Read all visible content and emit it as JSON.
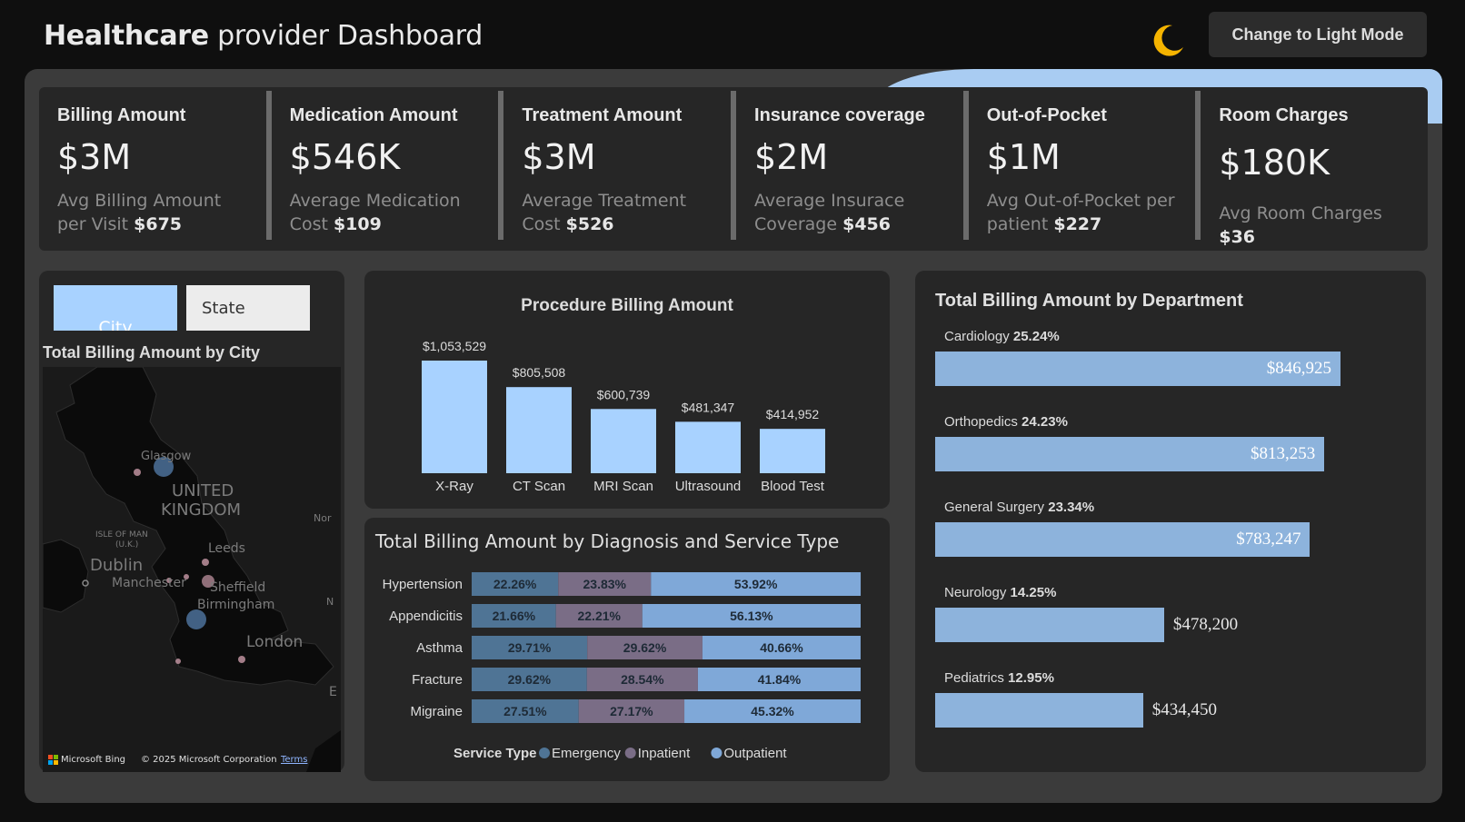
{
  "header": {
    "title_bold": "Healthcare",
    "title_rest": " provider Dashboard",
    "mode_button": "Change to Light Mode"
  },
  "kpis": [
    {
      "label": "Billing Amount",
      "value": "$3M",
      "sub": "Avg Billing Amount per Visit ",
      "sub_value": "$675"
    },
    {
      "label": "Medication Amount",
      "value": "$546K",
      "sub": "Average Medication Cost ",
      "sub_value": "$109"
    },
    {
      "label": "Treatment Amount",
      "value": "$3M",
      "sub": "Average Treatment Cost ",
      "sub_value": "$526"
    },
    {
      "label": "Insurance coverage",
      "value": "$2M",
      "sub": "Average Insurace Coverage ",
      "sub_value": "$456"
    },
    {
      "label": "Out-of-Pocket",
      "value": "$1M",
      "sub": "Avg Out-of-Pocket per patient ",
      "sub_value": "$227"
    },
    {
      "label": "Room Charges",
      "value": "$180K",
      "sub": "Avg Room Charges ",
      "sub_value": "$36"
    }
  ],
  "map": {
    "city_button": "City",
    "state_button": "State",
    "title": "Total Billing Amount by City",
    "labels": {
      "glasgow": "Glasgow",
      "uk_line1": "UNITED",
      "uk_line2": "KINGDOM",
      "isle_line1": "ISLE OF MAN",
      "isle_line2": "(U.K.)",
      "dublin": "Dublin",
      "leeds": "Leeds",
      "manchester": "Manchester",
      "sheffield": "Sheffield",
      "birmingham": "Birmingham",
      "london": "London",
      "nor": "Nor",
      "n": "N",
      "e": "E"
    },
    "bing": "Microsoft Bing",
    "copyright": "© 2025 Microsoft Corporation",
    "terms": "Terms"
  },
  "chart_data": [
    {
      "type": "bar",
      "title": "Procedure Billing Amount",
      "categories": [
        "X-Ray",
        "CT Scan",
        "MRI Scan",
        "Ultrasound",
        "Blood Test"
      ],
      "values": [
        1053529,
        805508,
        600739,
        481347,
        414952
      ],
      "value_labels": [
        "$1,053,529",
        "$805,508",
        "$600,739",
        "$481,347",
        "$414,952"
      ],
      "color": "#a8d2ff"
    },
    {
      "type": "bar",
      "orientation": "horizontal-stacked-100",
      "title": "Total Billing Amount by Diagnosis and Service Type",
      "categories": [
        "Hypertension",
        "Appendicitis",
        "Asthma",
        "Fracture",
        "Migraine"
      ],
      "legend_title": "Service Type",
      "series": [
        {
          "name": "Emergency",
          "color": "#4f7495",
          "values": [
            22.26,
            21.66,
            29.71,
            29.62,
            27.51
          ]
        },
        {
          "name": "Inpatient",
          "color": "#7a6d86",
          "values": [
            23.83,
            22.21,
            29.62,
            28.54,
            27.17
          ]
        },
        {
          "name": "Outpatient",
          "color": "#7fa8d8",
          "values": [
            53.92,
            56.13,
            40.66,
            41.84,
            45.32
          ]
        }
      ]
    },
    {
      "type": "bar",
      "orientation": "horizontal",
      "title": "Total Billing Amount by Department",
      "categories": [
        "Cardiology",
        "Orthopedics",
        "General Surgery",
        "Neurology",
        "Pediatrics"
      ],
      "shares": [
        "25.24%",
        "24.23%",
        "23.34%",
        "14.25%",
        "12.95%"
      ],
      "values": [
        846925,
        813253,
        783247,
        478200,
        434450
      ],
      "value_labels": [
        "$846,925",
        "$813,253",
        "$783,247",
        "$478,200",
        "$434,450"
      ],
      "color": "#8db3dc"
    }
  ]
}
